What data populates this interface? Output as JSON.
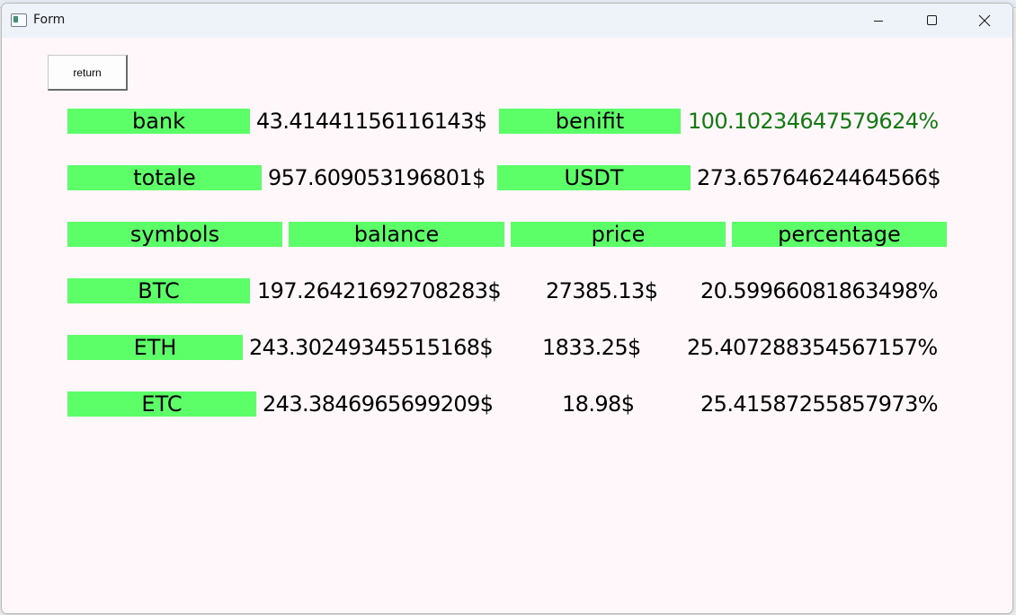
{
  "window": {
    "title": "Form"
  },
  "buttons": {
    "return_label": "return"
  },
  "summary": {
    "bank_label": "bank",
    "bank_value": "43.41441156116143$",
    "benefit_label": "benifit",
    "benefit_value": "100.10234647579624%",
    "benefit_color": "#127a12",
    "total_label": "totale",
    "total_value": "957.609053196801$",
    "usdt_label": "USDT",
    "usdt_value": "273.65764624464566$"
  },
  "table": {
    "headers": [
      "symbols",
      "balance",
      "price",
      "percentage"
    ],
    "rows": [
      {
        "symbol": "BTC",
        "balance": "197.26421692708283$",
        "price": "27385.13$",
        "percentage": "20.59966081863498%"
      },
      {
        "symbol": "ETH",
        "balance": "243.30249345515168$",
        "price": "1833.25$",
        "percentage": "25.407288354567157%"
      },
      {
        "symbol": "ETC",
        "balance": "243.3846965699209$",
        "price": "18.98$",
        "percentage": "25.41587255857973%"
      }
    ]
  },
  "colors": {
    "label_background": "#5cff68",
    "window_background": "#fff7f9"
  }
}
